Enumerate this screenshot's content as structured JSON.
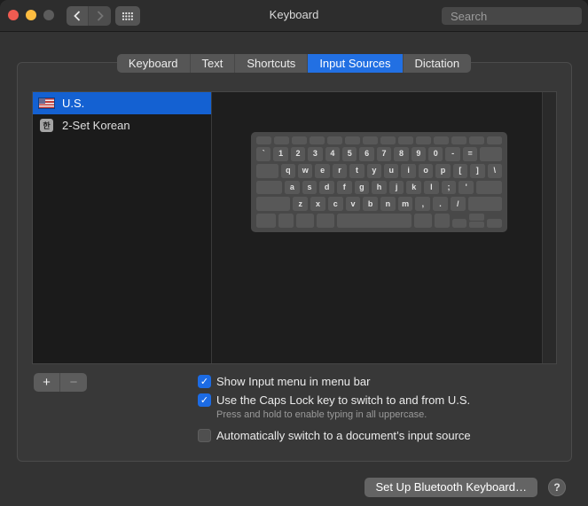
{
  "window": {
    "title": "Keyboard"
  },
  "titlebar": {
    "search": {
      "placeholder": "Search"
    }
  },
  "tabs": {
    "items": [
      {
        "label": "Keyboard",
        "selected": false
      },
      {
        "label": "Text",
        "selected": false
      },
      {
        "label": "Shortcuts",
        "selected": false
      },
      {
        "label": "Input Sources",
        "selected": true
      },
      {
        "label": "Dictation",
        "selected": false
      }
    ]
  },
  "input_sources": {
    "items": [
      {
        "label": "U.S.",
        "icon": "us-flag-icon",
        "selected": true
      },
      {
        "label": "2-Set Korean",
        "icon": "hangul-badge-icon",
        "badge": "한",
        "selected": false
      }
    ]
  },
  "keyboard_preview": {
    "rows": [
      {
        "h": 9,
        "keys": [
          {
            "f": 1
          },
          {
            "f": 1
          },
          {
            "f": 1
          },
          {
            "f": 1
          },
          {
            "f": 1
          },
          {
            "f": 1
          },
          {
            "f": 1
          },
          {
            "f": 1
          },
          {
            "f": 1
          },
          {
            "f": 1
          },
          {
            "f": 1
          },
          {
            "f": 1
          },
          {
            "f": 1
          },
          {
            "f": 1
          }
        ]
      },
      {
        "h": 16,
        "keys": [
          {
            "l": "`"
          },
          {
            "l": "1"
          },
          {
            "l": "2"
          },
          {
            "l": "3"
          },
          {
            "l": "4"
          },
          {
            "l": "5"
          },
          {
            "l": "6"
          },
          {
            "l": "7"
          },
          {
            "l": "8"
          },
          {
            "l": "9"
          },
          {
            "l": "0"
          },
          {
            "l": "-"
          },
          {
            "l": "="
          },
          {
            "f": 1.5
          }
        ]
      },
      {
        "h": 16,
        "keys": [
          {
            "f": 1.5
          },
          {
            "l": "q"
          },
          {
            "l": "w"
          },
          {
            "l": "e"
          },
          {
            "l": "r"
          },
          {
            "l": "t"
          },
          {
            "l": "y"
          },
          {
            "l": "u"
          },
          {
            "l": "i"
          },
          {
            "l": "o"
          },
          {
            "l": "p"
          },
          {
            "l": "["
          },
          {
            "l": "]"
          },
          {
            "l": "\\"
          }
        ]
      },
      {
        "h": 16,
        "keys": [
          {
            "f": 1.75
          },
          {
            "l": "a"
          },
          {
            "l": "s"
          },
          {
            "l": "d"
          },
          {
            "l": "f"
          },
          {
            "l": "g"
          },
          {
            "l": "h"
          },
          {
            "l": "j"
          },
          {
            "l": "k"
          },
          {
            "l": "l"
          },
          {
            "l": ";"
          },
          {
            "l": "'"
          },
          {
            "f": 1.75
          }
        ]
      },
      {
        "h": 16,
        "keys": [
          {
            "f": 2.3
          },
          {
            "l": "z"
          },
          {
            "l": "x"
          },
          {
            "l": "c"
          },
          {
            "l": "v"
          },
          {
            "l": "b"
          },
          {
            "l": "n"
          },
          {
            "l": "m"
          },
          {
            "l": ","
          },
          {
            "l": "."
          },
          {
            "l": "/"
          },
          {
            "f": 2.3
          }
        ]
      },
      {
        "h": 16,
        "keys": [
          {
            "f": 1.3
          },
          {
            "f": 1
          },
          {
            "f": 1.2
          },
          {
            "f": 1.2
          },
          {
            "f": 5.0
          },
          {
            "f": 1.2
          },
          {
            "f": 1
          },
          {
            "f": 1,
            "t": "half"
          },
          {
            "f": 1,
            "t": "stack"
          },
          {
            "f": 1,
            "t": "half"
          }
        ]
      }
    ]
  },
  "controls": {
    "add_label": "+",
    "remove_label": "−"
  },
  "checkboxes": [
    {
      "label": "Show Input menu in menu bar",
      "checked": true
    },
    {
      "label": "Use the Caps Lock key to switch to and from U.S.",
      "checked": true,
      "subtext": "Press and hold to enable typing in all uppercase."
    },
    {
      "label": "Automatically switch to a document’s input source",
      "checked": false
    }
  ],
  "footer": {
    "bluetooth_button": "Set Up Bluetooth Keyboard…",
    "help_label": "?"
  },
  "icons": {
    "checkmark": "✓"
  },
  "colors": {
    "accent_tab": "#2270e3",
    "selection_blue": "#1461d2",
    "checkbox_blue": "#1c6be4",
    "traffic_close": "#f05b51",
    "traffic_minimize": "#fdbc40",
    "traffic_zoom_disabled": "#5c5c5c"
  }
}
